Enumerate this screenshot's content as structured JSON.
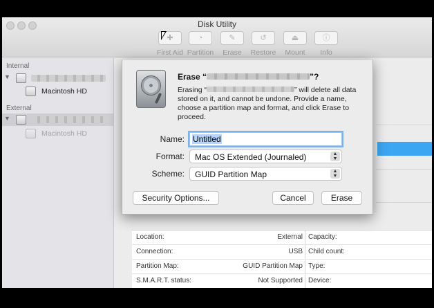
{
  "window": {
    "title": "Disk Utility"
  },
  "toolbar": {
    "items": [
      {
        "label": "First Aid",
        "icon": "stethoscope-icon",
        "glyph": "✚"
      },
      {
        "label": "Partition",
        "icon": "partition-icon",
        "glyph": "◔"
      },
      {
        "label": "Erase",
        "icon": "erase-icon",
        "glyph": "✎"
      },
      {
        "label": "Restore",
        "icon": "restore-icon",
        "glyph": "↺"
      },
      {
        "label": "Mount",
        "icon": "mount-icon",
        "glyph": "⏏"
      },
      {
        "label": "Info",
        "icon": "info-icon",
        "glyph": "ⓘ"
      }
    ]
  },
  "sidebar": {
    "internal_label": "Internal",
    "external_label": "External",
    "internal_volume": "Macintosh HD",
    "external_volume": "Macintosh HD"
  },
  "dialog": {
    "title_prefix": "Erase “",
    "title_suffix": "”?",
    "body_prefix": "Erasing “",
    "body_suffix": "” will delete all data stored on it, and cannot be undone. Provide a name, choose a partition map and format, and click Erase to proceed.",
    "name_label": "Name:",
    "name_value": "Untitled",
    "format_label": "Format:",
    "format_value": "Mac OS Extended (Journaled)",
    "scheme_label": "Scheme:",
    "scheme_value": "GUID Partition Map",
    "security_button": "Security Options...",
    "cancel_button": "Cancel",
    "erase_button": "Erase"
  },
  "info": {
    "rows": [
      {
        "label": "Location:",
        "value": "External",
        "right_label": "Capacity:"
      },
      {
        "label": "Connection:",
        "value": "USB",
        "right_label": "Child count:"
      },
      {
        "label": "Partition Map:",
        "value": "GUID Partition Map",
        "right_label": "Type:"
      },
      {
        "label": "S.M.A.R.T. status:",
        "value": "Not Supported",
        "right_label": "Device:"
      }
    ]
  }
}
